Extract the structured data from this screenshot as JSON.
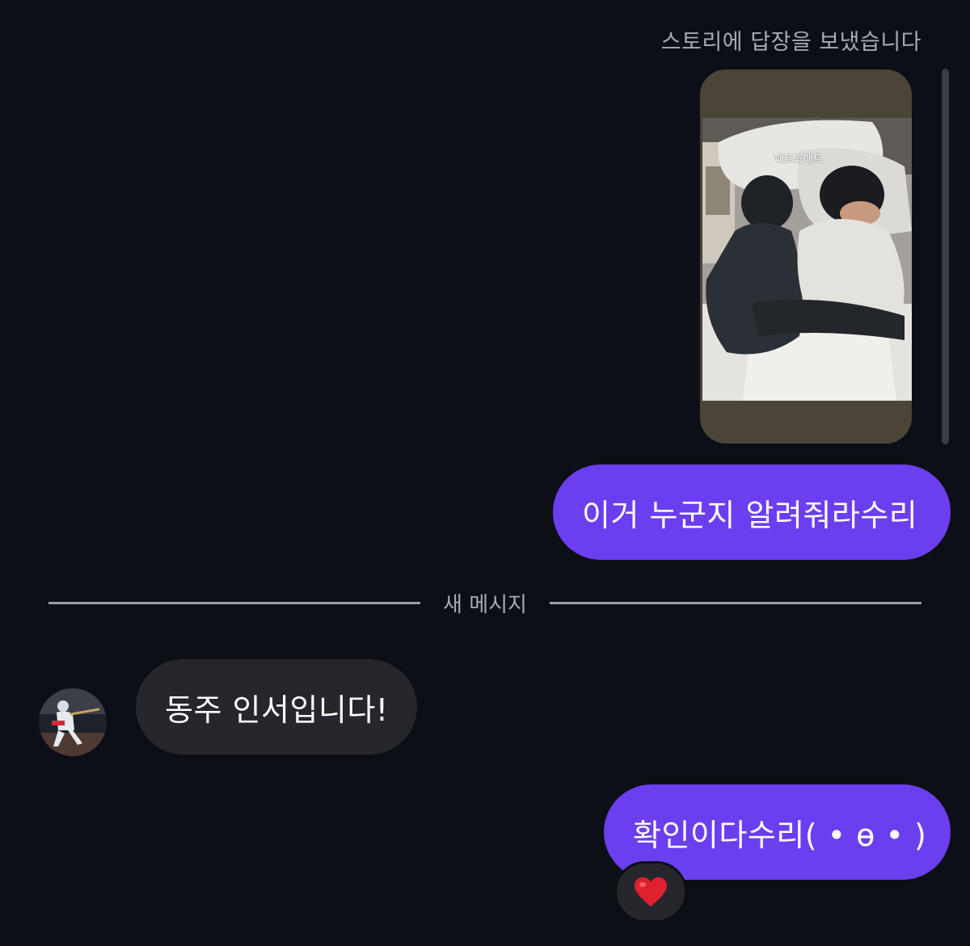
{
  "header": {
    "story_reply_label": "스토리에 답장을 보냈습니다"
  },
  "story": {
    "caption": "패트와매트"
  },
  "divider": {
    "label": "새 메시지"
  },
  "messages": [
    {
      "direction": "outgoing",
      "text": "이거 누군지 알려줘라수리"
    },
    {
      "direction": "incoming",
      "text": "동주 인서입니다!"
    },
    {
      "direction": "outgoing",
      "text": "확인이다수리( • ɵ • )"
    }
  ],
  "reaction": {
    "icon": "red-heart-icon"
  },
  "colors": {
    "background": "#0c0f15",
    "outgoing_bubble": "#6b3ef0",
    "incoming_bubble": "#25272c",
    "secondary_text": "#a8abb2",
    "heart": "#e0202e"
  }
}
